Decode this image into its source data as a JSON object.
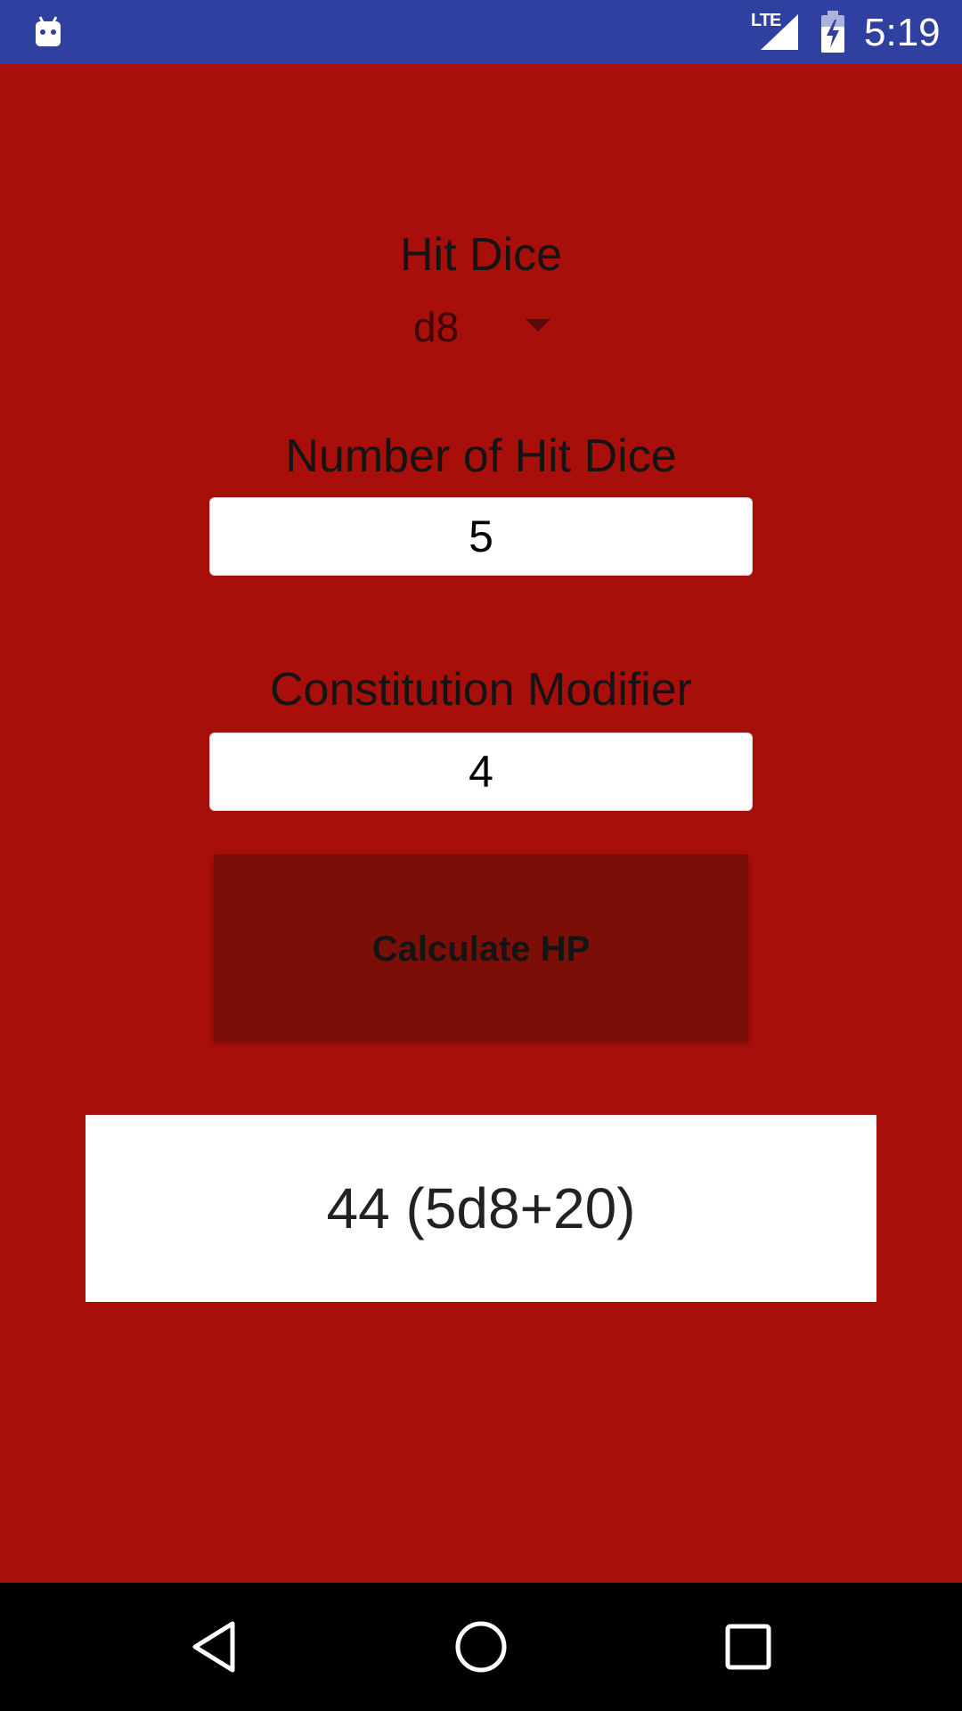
{
  "status_bar": {
    "network": "LTE",
    "time": "5:19",
    "background_color": "#3040a0",
    "icons": [
      "android-debug-icon",
      "signal-icon",
      "battery-charging-icon"
    ]
  },
  "app": {
    "background_color": "#a80e0a",
    "hit_dice": {
      "label": "Hit Dice",
      "selected": "d8"
    },
    "number_of_hit_dice": {
      "label": "Number of Hit Dice",
      "value": "5"
    },
    "constitution_modifier": {
      "label": "Constitution Modifier",
      "value": "4"
    },
    "calculate_button": {
      "label": "Calculate HP",
      "color": "#7c0e08"
    },
    "result": "44 (5d8+20)"
  },
  "nav_bar": {
    "buttons": [
      "back-icon",
      "home-icon",
      "recents-icon"
    ]
  }
}
